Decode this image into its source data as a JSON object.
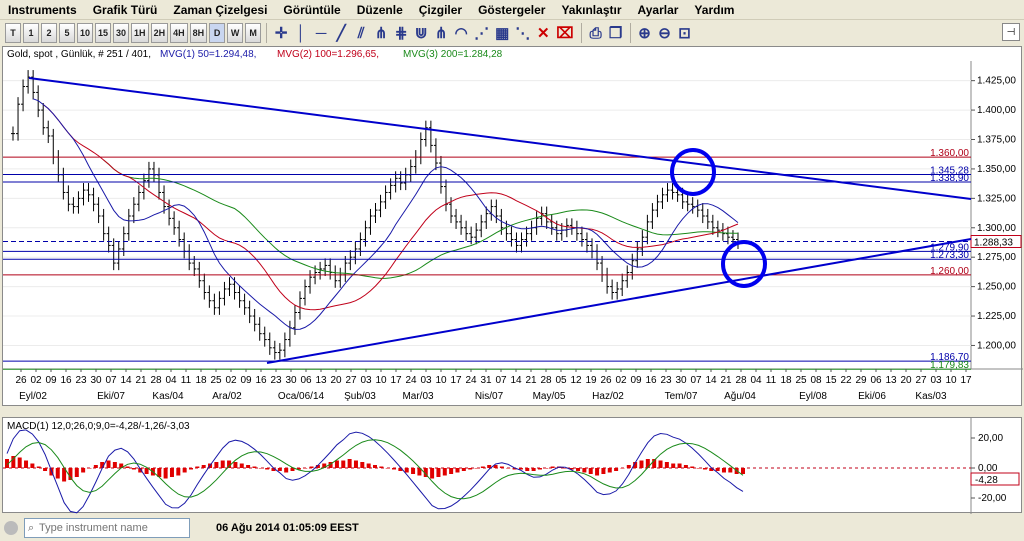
{
  "menu": [
    "Instruments",
    "Grafik Türü",
    "Zaman Çizelgesi",
    "Görüntüle",
    "Düzenle",
    "Çizgiler",
    "Göstergeler",
    "Yakınlaştır",
    "Ayarlar",
    "Yardım"
  ],
  "toolbar": {
    "timeframes": [
      "T",
      "1",
      "2",
      "5",
      "10",
      "15",
      "30",
      "1H",
      "2H",
      "4H",
      "8H",
      "D",
      "W",
      "M"
    ],
    "active_timeframe": "D",
    "tools": [
      "crosshair-icon",
      "vertical-line-icon",
      "horizontal-line-icon",
      "trend-line-icon",
      "channel-icon",
      "fib-fan-icon",
      "fib-retracement-icon",
      "fib-extension-icon",
      "andrews-pitchfork-icon",
      "arc-icon",
      "gann-fan-icon",
      "gann-box-icon",
      "speed-line-icon",
      "delete-drawing-icon",
      "delete-all-icon",
      "print-icon",
      "copy-icon",
      "zoom-in-icon",
      "zoom-out-icon",
      "zoom-fit-icon"
    ]
  },
  "chart": {
    "header": {
      "instrument": "Gold, spot , Günlük, # 251 / 401,",
      "mvg1": "MVG(1) 50=1.294,48,",
      "mvg2": "MVG(2) 100=1.296,65,",
      "mvg3": "MVG(3) 200=1.284,28"
    },
    "colors": {
      "mvg1": "#1a1aa8",
      "mvg2": "#c0001a",
      "mvg3": "#1a8a1a",
      "trend": "#0000cc",
      "hline_red": "#b00018",
      "hline_blue": "#0000aa",
      "circle": "#0000ee"
    },
    "price_axis": [
      "1.425,00",
      "1.400,00",
      "1.375,00",
      "1.350,00",
      "1.325,00",
      "1.300,00",
      "1.275,00",
      "1.250,00",
      "1.225,00",
      "1.200,00"
    ],
    "price_range": [
      1180,
      1440
    ],
    "levels": [
      {
        "label": "1.360,00",
        "value": 1360,
        "color": "red"
      },
      {
        "label": "1.345,28",
        "value": 1345.28,
        "color": "blue"
      },
      {
        "label": "1.338,90",
        "value": 1338.9,
        "color": "blue"
      },
      {
        "label": "1.279,90",
        "value": 1279.9,
        "color": "blue"
      },
      {
        "label": "1.273,30",
        "value": 1273.3,
        "color": "blue"
      },
      {
        "label": "1.260,00",
        "value": 1260,
        "color": "red"
      },
      {
        "label": "1.186,70",
        "value": 1186.7,
        "color": "blue"
      },
      {
        "label": "1.179,83",
        "value": 1179.83,
        "color": "green"
      }
    ],
    "current_price": {
      "label": "1.288,33",
      "value": 1288.33
    },
    "date_ticks": [
      "26",
      "02",
      "09",
      "16",
      "23",
      "30",
      "07",
      "14",
      "21",
      "28",
      "04",
      "11",
      "18",
      "25",
      "02",
      "09",
      "16",
      "23",
      "30",
      "06",
      "13",
      "20",
      "27",
      "03",
      "10",
      "17",
      "24",
      "03",
      "10",
      "17",
      "24",
      "31",
      "07",
      "14",
      "21",
      "28",
      "05",
      "12",
      "19",
      "26",
      "02",
      "09",
      "16",
      "23",
      "30",
      "07",
      "14",
      "21",
      "28",
      "04",
      "11",
      "18",
      "25",
      "08",
      "15",
      "22",
      "29",
      "06",
      "13",
      "20",
      "27",
      "03",
      "10",
      "17"
    ],
    "month_labels": [
      "Eyl/02",
      "Eki/07",
      "Kas/04",
      "Ara/02",
      "Oca/06/14",
      "Şub/03",
      "Mar/03",
      "Nis/07",
      "May/05",
      "Haz/02",
      "Tem/07",
      "Ağu/04",
      "Eyl/08",
      "Eki/06",
      "Kas/03"
    ],
    "candles": [
      1380,
      1405,
      1420,
      1428,
      1415,
      1400,
      1385,
      1378,
      1360,
      1345,
      1330,
      1320,
      1318,
      1325,
      1332,
      1328,
      1320,
      1310,
      1295,
      1285,
      1270,
      1282,
      1295,
      1310,
      1320,
      1330,
      1340,
      1350,
      1345,
      1330,
      1318,
      1308,
      1300,
      1290,
      1280,
      1270,
      1265,
      1255,
      1245,
      1238,
      1232,
      1240,
      1248,
      1252,
      1245,
      1238,
      1232,
      1225,
      1218,
      1210,
      1205,
      1198,
      1194,
      1196,
      1205,
      1215,
      1228,
      1240,
      1250,
      1258,
      1262,
      1265,
      1268,
      1262,
      1255,
      1260,
      1270,
      1275,
      1282,
      1290,
      1300,
      1310,
      1315,
      1322,
      1330,
      1336,
      1342,
      1338,
      1345,
      1352,
      1360,
      1375,
      1385,
      1370,
      1355,
      1335,
      1320,
      1310,
      1305,
      1300,
      1295,
      1292,
      1298,
      1305,
      1312,
      1318,
      1310,
      1300,
      1295,
      1290,
      1285,
      1290,
      1295,
      1300,
      1308,
      1312,
      1305,
      1300,
      1295,
      1298,
      1302,
      1300,
      1295,
      1290,
      1285,
      1280,
      1270,
      1260,
      1250,
      1245,
      1248,
      1255,
      1262,
      1272,
      1282,
      1292,
      1305,
      1315,
      1322,
      1328,
      1332,
      1330,
      1328,
      1322,
      1320,
      1318,
      1315,
      1310,
      1305,
      1300,
      1298,
      1295,
      1292,
      1290,
      1288
    ],
    "annotations": [
      "upper-circle",
      "lower-circle"
    ]
  },
  "macd": {
    "label": "MACD(1) 12,0;26,0;9,0=-4,28/-1,26/-3,03",
    "axis": [
      "20,00",
      "0,00",
      "-20,00"
    ],
    "current": "-4,28",
    "hist": [
      6,
      8,
      7,
      5,
      3,
      1,
      -2,
      -5,
      -7,
      -9,
      -8,
      -6,
      -3,
      0,
      2,
      4,
      5,
      4,
      3,
      1,
      -1,
      -3,
      -4,
      -5,
      -6,
      -7,
      -6,
      -5,
      -3,
      -1,
      1,
      2,
      3,
      4,
      5,
      5,
      4,
      3,
      2,
      1,
      0,
      -1,
      -2,
      -2,
      -3,
      -2,
      -1,
      0,
      1,
      2,
      3,
      4,
      5,
      5,
      6,
      5,
      4,
      3,
      2,
      1,
      0,
      -1,
      -2,
      -3,
      -4,
      -5,
      -6,
      -7,
      -6,
      -5,
      -4,
      -3,
      -2,
      -1,
      0,
      1,
      2,
      2,
      1,
      0,
      -1,
      -1,
      -2,
      -2,
      -1,
      0,
      1,
      1,
      0,
      -1,
      -2,
      -3,
      -4,
      -5,
      -4,
      -3,
      -2,
      0,
      2,
      4,
      5,
      6,
      6,
      5,
      4,
      3,
      3,
      2,
      1,
      0,
      -1,
      -2,
      -2,
      -3,
      -3,
      -4,
      -4
    ]
  },
  "status": {
    "input_placeholder": "Type instrument name",
    "timestamp": "06 Ağu 2014 01:05:09 EEST"
  }
}
